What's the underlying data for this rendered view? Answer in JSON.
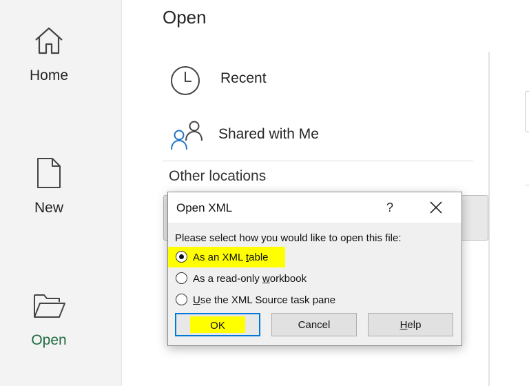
{
  "nav": {
    "home_label": "Home",
    "new_label": "New",
    "open_label": "Open",
    "active_color": "#1e6b3e"
  },
  "main": {
    "title": "Open",
    "recent_label": "Recent",
    "shared_label": "Shared with Me",
    "other_locations_label": "Other locations"
  },
  "dialog": {
    "title": "Open XML",
    "help_glyph": "?",
    "prompt": "Please select how you would like to open this file:",
    "options": [
      {
        "pre": "As an XML ",
        "accel": "t",
        "post": "able",
        "selected": true
      },
      {
        "pre": "As a read-only ",
        "accel": "w",
        "post": "orkbook",
        "selected": false
      },
      {
        "pre": "",
        "accel": "U",
        "post": "se the XML Source task pane",
        "selected": false
      }
    ],
    "ok_label": "OK",
    "cancel_label": "Cancel",
    "help_pre": "",
    "help_accel": "H",
    "help_post": "elp",
    "highlight_color": "#ffff00",
    "focus_color": "#0078d7"
  }
}
